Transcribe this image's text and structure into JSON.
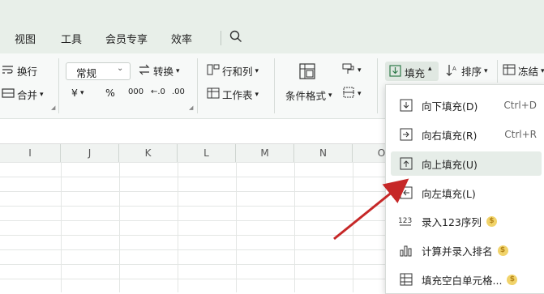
{
  "tabs": [
    "视图",
    "工具",
    "会员专享",
    "效率"
  ],
  "ribbon": {
    "wrap_text": "换行",
    "merge": "合并",
    "number_format": "常规",
    "convert": "转换",
    "rows_cols": "行和列",
    "worksheet": "工作表",
    "cond_format": "条件格式",
    "fill": "填充",
    "sort": "排序",
    "freeze": "冻结",
    "currency_symbol": "¥",
    "percent_symbol": "%",
    "thousands_symbol": "000"
  },
  "columns": [
    "I",
    "J",
    "K",
    "L",
    "M",
    "N",
    "O"
  ],
  "fill_menu": {
    "items": [
      {
        "label": "向下填充(D)",
        "shortcut": "Ctrl+D",
        "icon": "fill-down-icon"
      },
      {
        "label": "向右填充(R)",
        "shortcut": "Ctrl+R",
        "icon": "fill-right-icon"
      },
      {
        "label": "向上填充(U)",
        "shortcut": "",
        "icon": "fill-up-icon"
      },
      {
        "label": "向左填充(L)",
        "shortcut": "",
        "icon": "fill-left-icon"
      },
      {
        "label": "录入123序列",
        "shortcut": "",
        "icon": "sequence-icon"
      },
      {
        "label": "计算并录入排名",
        "shortcut": "",
        "icon": "rank-icon"
      },
      {
        "label": "填充空白单元格...",
        "shortcut": "",
        "icon": "blank-fill-icon"
      }
    ],
    "premium_badge": "$"
  },
  "colors": {
    "accent": "#2f7a4a",
    "arrow": "#c62828",
    "highlight": "#e6ede8"
  }
}
